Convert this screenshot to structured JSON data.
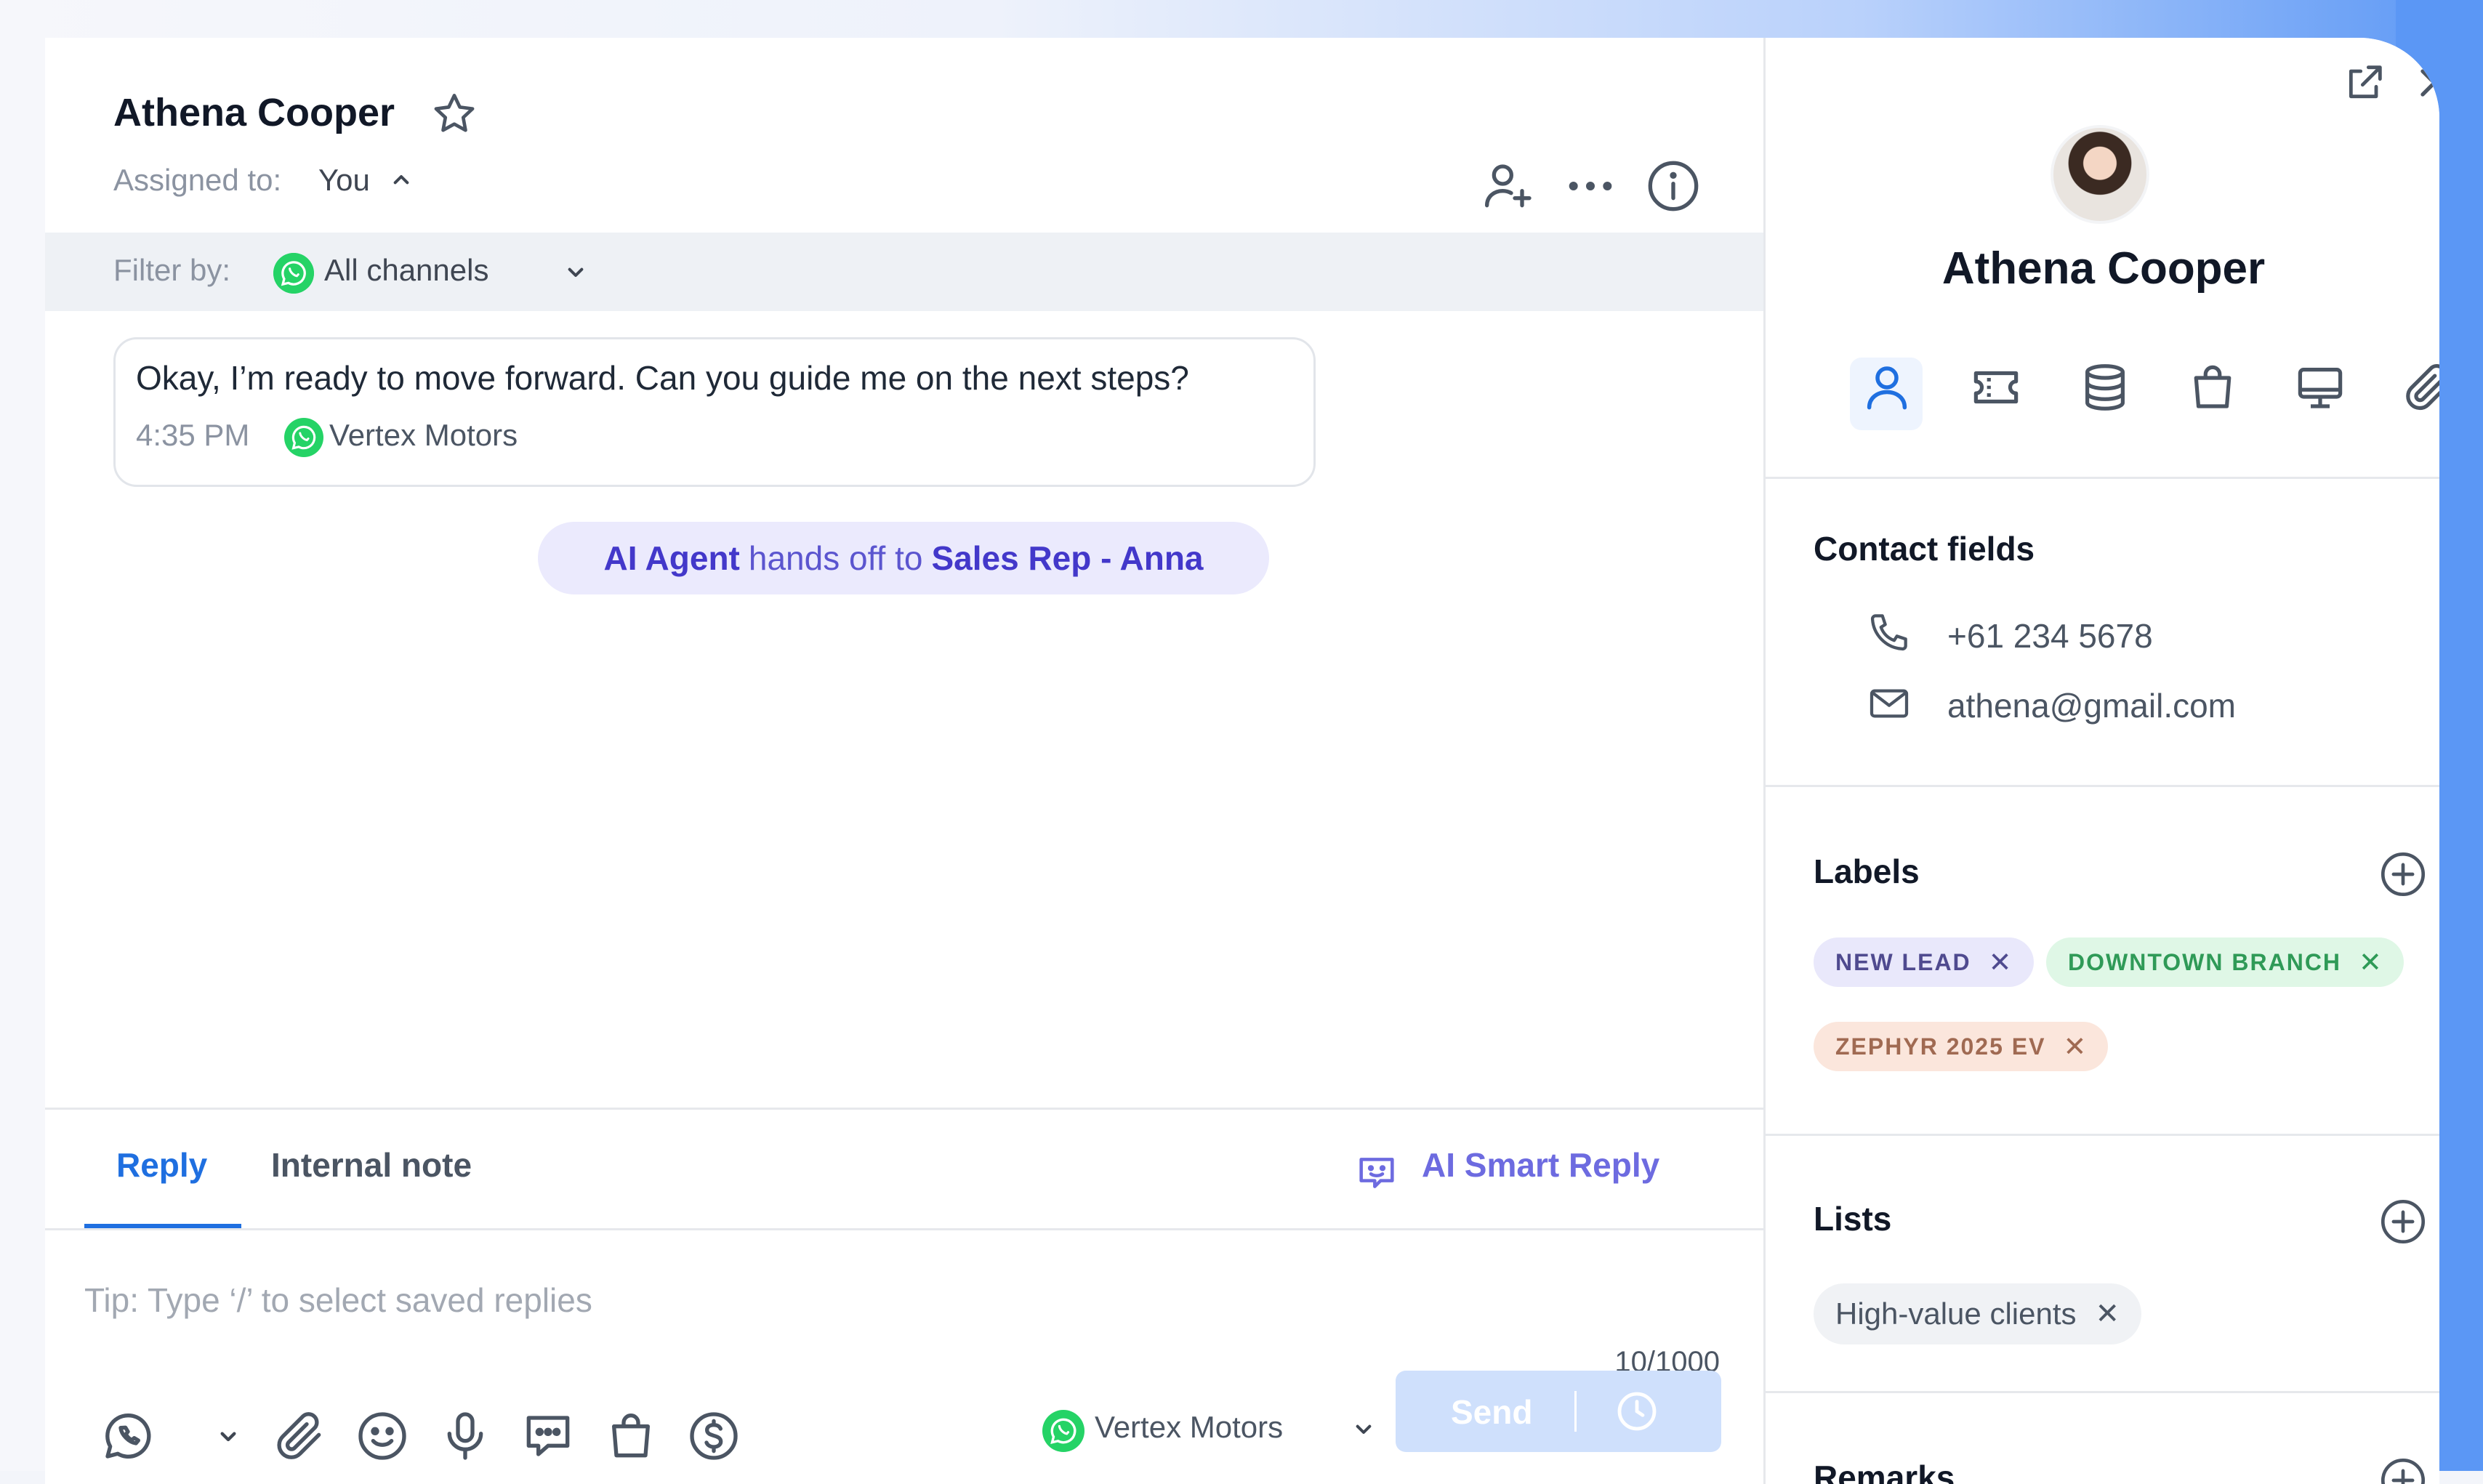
{
  "colors": {
    "accent_blue": "#1f6fe0",
    "ai_purple": "#6d6be0",
    "whatsapp_green": "#25d366",
    "send_disabled": "#cfe0fc"
  },
  "conversation": {
    "contact_name": "Athena Cooper",
    "assigned_label": "Assigned to:",
    "assigned_value": "You",
    "header_icons": [
      "add-user-icon",
      "more-icon",
      "info-icon"
    ]
  },
  "filter": {
    "label": "Filter by:",
    "value": "All channels"
  },
  "message": {
    "text": "Okay, I’m ready to move forward. Can you guide me on the next steps?",
    "time": "4:35 PM",
    "channel": "Vertex Motors"
  },
  "handoff": {
    "from": "AI Agent",
    "middle": "hands off to",
    "to": "Sales Rep - Anna"
  },
  "composer": {
    "tab_reply": "Reply",
    "tab_note": "Internal note",
    "ai_smart_reply": "AI Smart Reply",
    "placeholder": "Tip: Type ‘/’ to select saved replies",
    "counter": "10/1000",
    "channel": "Vertex Motors",
    "send_label": "Send",
    "tool_icons": [
      "whatsapp-icon",
      "attachment-icon",
      "emoji-icon",
      "microphone-icon",
      "message-template-icon",
      "shopping-bag-icon",
      "dollar-icon"
    ]
  },
  "side_panel": {
    "name": "Athena Cooper",
    "tabs": [
      "contact-icon",
      "ticket-icon",
      "database-icon",
      "shopping-bag-icon",
      "monitor-icon",
      "attachment-icon"
    ],
    "contact_fields": {
      "title": "Contact fields",
      "phone": "+61 234 5678",
      "email": "athena@gmail.com"
    },
    "labels": {
      "title": "Labels",
      "items": [
        {
          "text": "NEW LEAD",
          "bg": "#e9e8fb",
          "fg": "#4f4a8f"
        },
        {
          "text": "DOWNTOWN BRANCH",
          "bg": "#dff7e6",
          "fg": "#2f9a57"
        },
        {
          "text": "ZEPHYR 2025 EV",
          "bg": "#fbe6dc",
          "fg": "#a06a52"
        }
      ]
    },
    "lists": {
      "title": "Lists",
      "items": [
        "High-value clients"
      ]
    },
    "remarks": {
      "title": "Remarks"
    }
  }
}
